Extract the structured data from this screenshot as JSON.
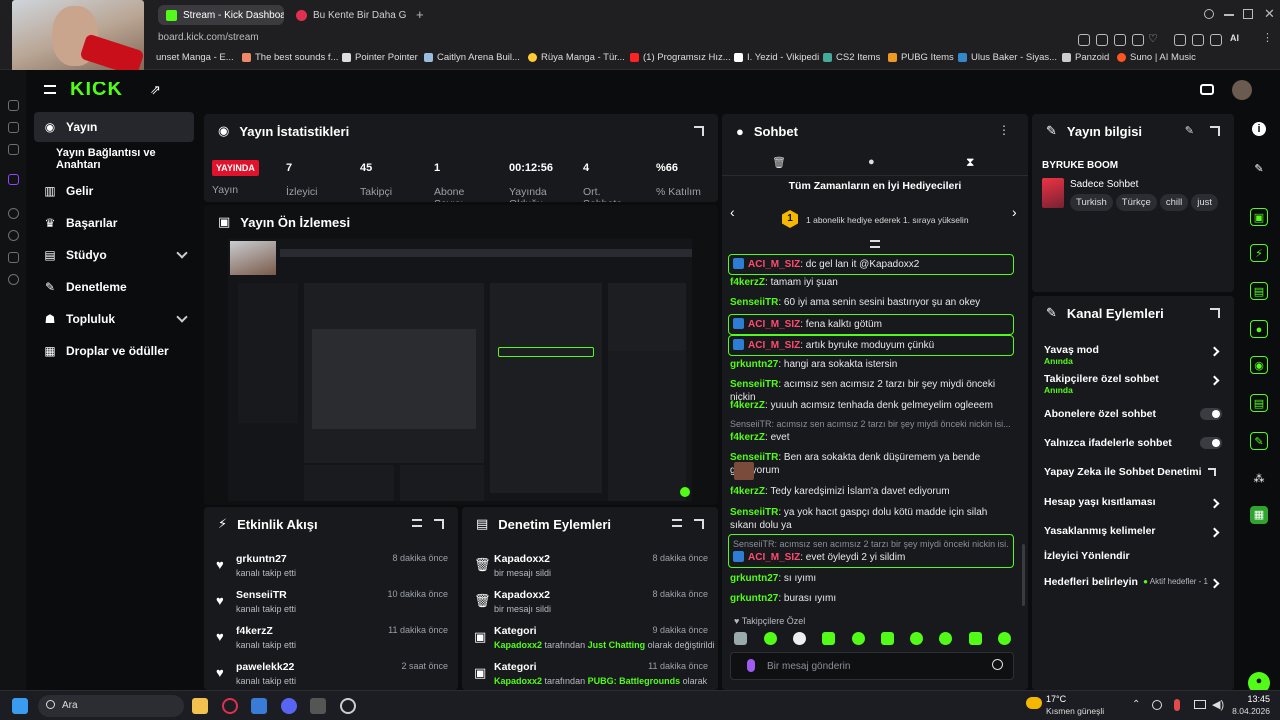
{
  "browser": {
    "tabs": [
      {
        "label": "Stream - Kick Dashboard",
        "active": true
      },
      {
        "label": "Bu Kente Bir Daha Gel",
        "active": false
      }
    ],
    "new_tab": "+",
    "url": "board.kick.com/stream",
    "bookmarks": [
      "unset Manga - E...",
      "The best sounds f...",
      "Pointer Pointer",
      "Caitlyn Arena Buil...",
      "Rüya Manga - Tür...",
      "(1) Programsız Hız...",
      "I. Yezid - Vikipedi",
      "CS2 Items",
      "PUBG Items",
      "Ulus Baker - Siyas...",
      "Panzoid",
      "Suno | AI Music"
    ],
    "ai_label": "AI"
  },
  "sidebar": {
    "items": [
      {
        "label": "Yayın",
        "icon": "broadcast-icon",
        "active": true
      },
      {
        "label": "Yayın Bağlantısı ve Anahtarı",
        "icon": "",
        "sub": true
      },
      {
        "label": "Gelir",
        "icon": "chart-icon"
      },
      {
        "label": "Başarılar",
        "icon": "trophy-icon"
      },
      {
        "label": "Stüdyo",
        "icon": "studio-icon",
        "expand": true
      },
      {
        "label": "Denetleme",
        "icon": "wrench-icon"
      },
      {
        "label": "Topluluk",
        "icon": "community-icon",
        "expand": true
      },
      {
        "label": "Droplar ve ödüller",
        "icon": "drops-icon"
      }
    ]
  },
  "stats": {
    "title": "Yayın İstatistikleri",
    "live_badge": "YAYINDA",
    "live_label": "Yayın",
    "items": [
      {
        "value": "7",
        "label": "İzleyici"
      },
      {
        "value": "45",
        "label": "Takipçi"
      },
      {
        "value": "1",
        "label": "Abone Sayısı"
      },
      {
        "value": "00:12:56",
        "label": "Yayında Olduğu"
      },
      {
        "value": "4",
        "label": "Ort. Sohbete"
      },
      {
        "value": "%66",
        "label": "% Katılım"
      }
    ]
  },
  "preview": {
    "title": "Yayın Ön İzlemesi"
  },
  "activity": {
    "title": "Etkinlik Akışı",
    "rows": [
      {
        "user": "grkuntn27",
        "action": "kanalı takip etti",
        "time": "8 dakika önce"
      },
      {
        "user": "SenseiiTR",
        "action": "kanalı takip etti",
        "time": "10 dakika önce"
      },
      {
        "user": "f4kerzZ",
        "action": "kanalı takip etti",
        "time": "11 dakika önce"
      },
      {
        "user": "pawelekk22",
        "action": "kanalı takip etti",
        "time": "2 saat önce"
      }
    ]
  },
  "moderation": {
    "title": "Denetim Eylemleri",
    "rows": [
      {
        "user": "Kapadoxx2",
        "action": "bir mesajı sildi",
        "time": "8 dakika önce"
      },
      {
        "user": "Kapadoxx2",
        "action": "bir mesajı sildi",
        "time": "8 dakika önce"
      },
      {
        "title": "Kategori",
        "by": "Kapadoxx2",
        "mid": "tarafından",
        "cat": "Just Chatting",
        "end": "olarak değiştirildi",
        "time": "9 dakika önce"
      },
      {
        "title": "Kategori",
        "by": "Kapadoxx2",
        "mid": "tarafından",
        "cat": "PUBG: Battlegrounds",
        "end": "olarak",
        "time": "11 dakika önce"
      }
    ]
  },
  "chat": {
    "title": "Sohbet",
    "gifters_title": "Tüm Zamanların en İyi Hediyecileri",
    "gifters_rank": "1",
    "gifters_text": "1 abonelik hediye ederek 1. sıraya yükselin",
    "messages": [
      {
        "user": "ACI_M_SIZ",
        "text": "dc gel lan it @Kapadoxx2",
        "style": "p",
        "hl": true
      },
      {
        "user": "f4kerzZ",
        "text": "tamam iyi şuan",
        "style": "g"
      },
      {
        "user": "SenseiiTR",
        "text": "60 iyi ama senin sesini bastırıyor şu an okey",
        "style": "g"
      },
      {
        "user": "ACI_M_SIZ",
        "text": "fena kalktı götüm",
        "style": "p",
        "hl": true
      },
      {
        "user": "ACI_M_SIZ",
        "text": "artık byruke moduyum çünkü",
        "style": "p",
        "hl": true
      },
      {
        "user": "grkuntn27",
        "text": "hangi ara sokakta istersin",
        "style": "g"
      },
      {
        "user": "SenseiiTR",
        "text": "acımsız sen acımsız 2 tarzı bir şey miydi önceki nickin",
        "style": "g"
      },
      {
        "user": "f4kerzZ",
        "text": "yuuuh acımsız tenhada denk gelmeyelim ogleeem",
        "style": "g"
      },
      {
        "reply": "SenseiiTR: acımsız sen acımsız 2 tarzı bir şey miydi önceki nickin isi...",
        "user": "f4kerzZ",
        "text": "evet",
        "style": "g"
      },
      {
        "user": "SenseiiTR",
        "text": "Ben ara sokakta denk düşüremem ya bende girmiyorum",
        "style": "g"
      },
      {
        "user": "f4kerzZ",
        "text": "Tedy karedşimizi İslam'a davet ediyorum",
        "style": "g"
      },
      {
        "user": "SenseiiTR",
        "text": "ya yok hacıt gaspçı dolu kötü madde için silah sıkanı dolu ya",
        "style": "g"
      },
      {
        "reply": "SenseiiTR: acımsız sen acımsız 2 tarzı bir şey miydi önceki nickin isi...",
        "user": "ACI_M_SIZ",
        "text": "evet öyleydi 2 yi sildim",
        "style": "p",
        "hl": true
      },
      {
        "user": "grkuntn27",
        "text": "sı ıyımı",
        "style": "g"
      },
      {
        "user": "grkuntn27",
        "text": "burası ıyımı",
        "style": "g"
      }
    ],
    "followers_only": "Takipçilere Özel",
    "input_placeholder": "Bir mesaj gönderin"
  },
  "info": {
    "title": "Yayın bilgisi",
    "channel": "BYRUKE BOOM",
    "category": "Sadece Sohbet",
    "tags": [
      "Turkish",
      "Türkçe",
      "chill",
      "just"
    ]
  },
  "channel_actions": {
    "title": "Kanal Eylemleri",
    "items": [
      {
        "label": "Yavaş mod",
        "sub": "Anında",
        "kind": "arrow"
      },
      {
        "label": "Takipçilere özel sohbet",
        "sub": "Anında",
        "kind": "arrow"
      },
      {
        "label": "Abonelere özel sohbet",
        "kind": "toggle"
      },
      {
        "label": "Yalnızca ifadelerle sohbet",
        "kind": "toggle"
      },
      {
        "label": "Yapay Zeka ile Sohbet Denetimi",
        "kind": "ext"
      },
      {
        "label": "Hesap yaşı kısıtlaması",
        "kind": "arrow"
      },
      {
        "label": "Yasaklanmış kelimeler",
        "kind": "arrow"
      },
      {
        "label": "İzleyici Yönlendir",
        "kind": "none"
      },
      {
        "label": "Hedefleri belirleyin",
        "sub_inline": "Aktif hedefler - 1",
        "kind": "arrow"
      }
    ]
  },
  "taskbar": {
    "search": "Ara",
    "weather_temp": "17°C",
    "weather_text": "Kısmen güneşli",
    "time": "13:45",
    "date": "8.04.2026"
  },
  "colors": {
    "accent": "#53fc18",
    "live": "#e0122c",
    "panel": "#18191c"
  }
}
